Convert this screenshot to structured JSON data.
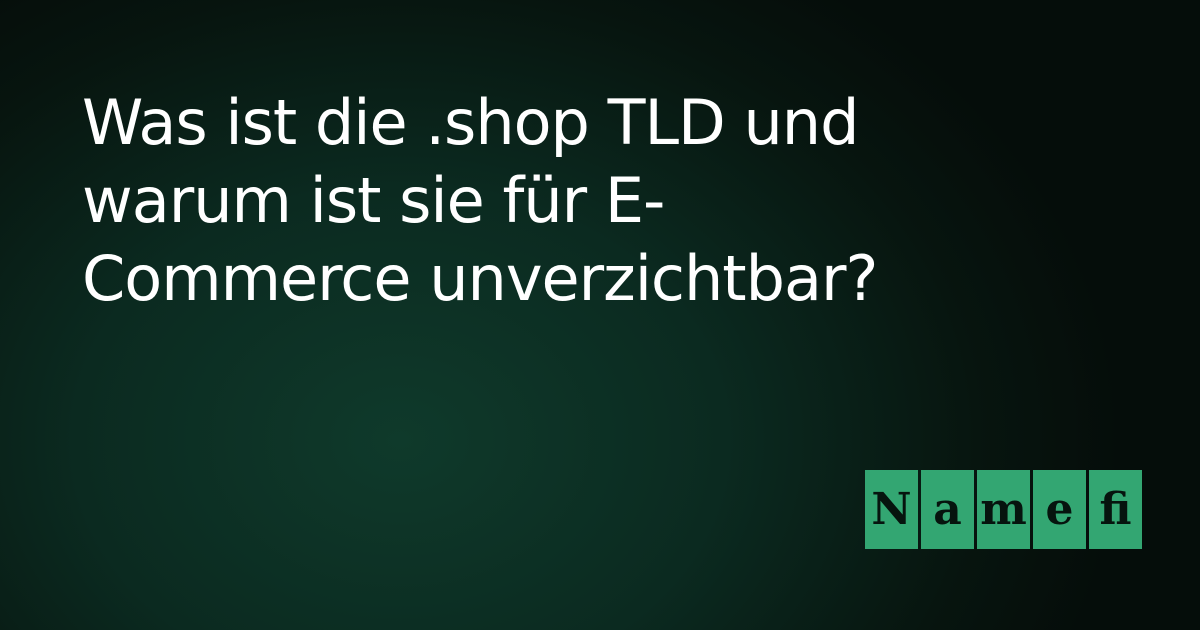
{
  "headline": {
    "text": "Was ist die .shop TLD und warum ist sie für E-Commerce unverzichtbar?"
  },
  "logo": {
    "text": "Namefi",
    "letters": [
      "N",
      "a",
      "m",
      "e",
      "fi"
    ],
    "tile_color": "#33a672",
    "letter_color": "#06140e"
  },
  "colors": {
    "background_dark": "#050d0a",
    "background_glow": "#0f3a2b",
    "text": "#ffffff"
  }
}
